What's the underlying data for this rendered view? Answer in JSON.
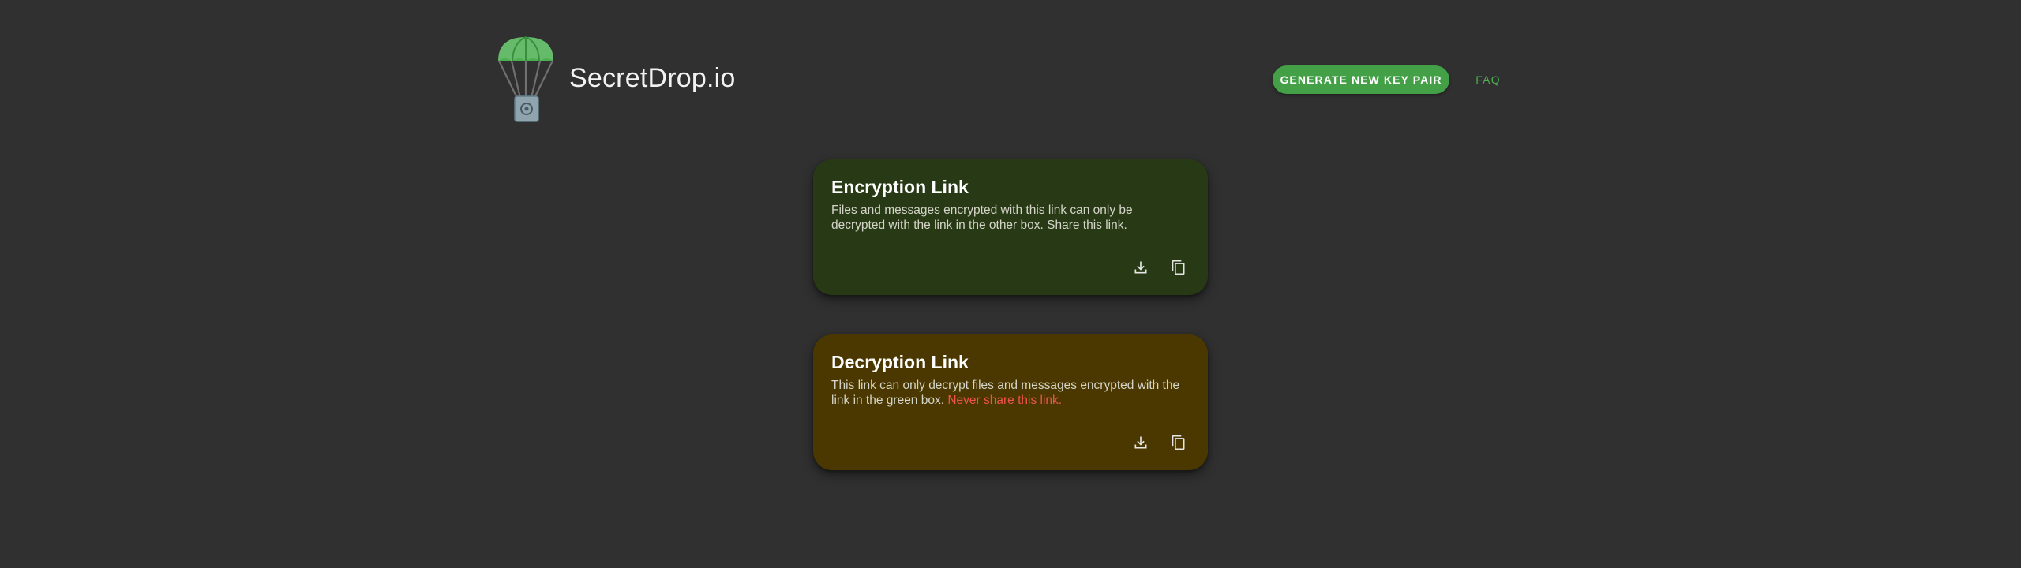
{
  "header": {
    "brand": "SecretDrop.io",
    "generate_button": "GENERATE NEW KEY PAIR",
    "faq_button": "FAQ"
  },
  "logo": {
    "icon": "parachute-box-icon",
    "canopy_color": "#66bb6a",
    "box_color": "#90a4ae"
  },
  "encryption_card": {
    "title": "Encryption Link",
    "description": "Files and messages encrypted with this link can only be decrypted with the link in the other box. Share this link.",
    "background": "#283a15",
    "actions": [
      "download-icon",
      "copy-icon"
    ]
  },
  "decryption_card": {
    "title": "Decryption Link",
    "description": "This link can only decrypt files and messages encrypted with the link in the green box.",
    "warning": "Never share this link.",
    "background": "#4b3800",
    "warning_color": "#ef5350",
    "actions": [
      "download-icon",
      "copy-icon"
    ]
  },
  "colors": {
    "page_background": "#303030",
    "accent": "#43a047"
  }
}
